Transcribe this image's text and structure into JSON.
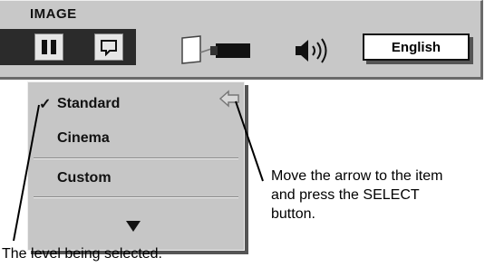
{
  "menu": {
    "title": "IMAGE",
    "icons": [
      "image-adjust-icon",
      "image-select-icon",
      "screen-icon",
      "projector-icon",
      "speaker-icon"
    ],
    "language_label": "English"
  },
  "dropdown": {
    "items": [
      {
        "label": "Standard",
        "checked": true
      },
      {
        "label": "Cinema",
        "checked": false
      },
      {
        "label": "Custom",
        "checked": false
      }
    ],
    "check_mark": "✓"
  },
  "annotations": {
    "arrow_note_line1": "Move the arrow to the item",
    "arrow_note_line2": "and press the SELECT",
    "arrow_note_line3": "button.",
    "level_note": "The level being selected."
  },
  "colors": {
    "menu_bg": "#c8c8c8",
    "selected_bg": "#2b2b2b",
    "text": "#000000"
  }
}
